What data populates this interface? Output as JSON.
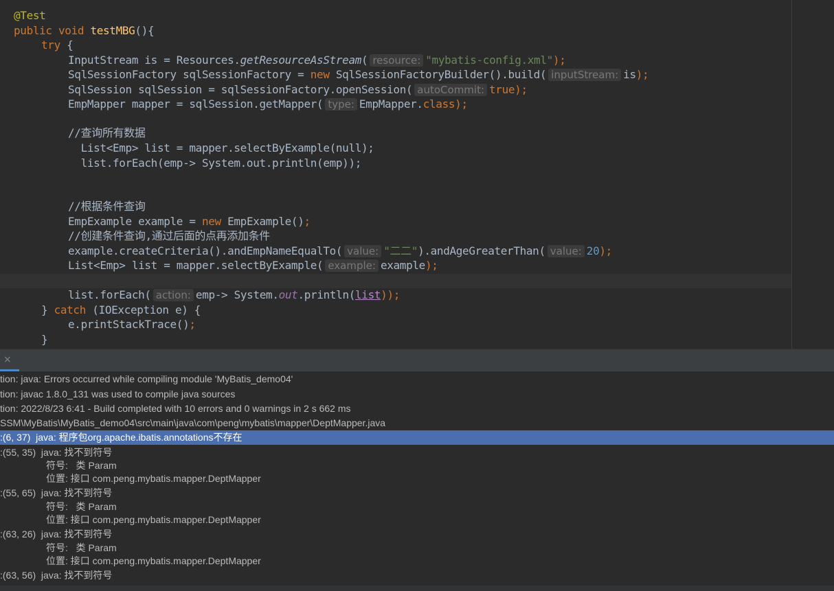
{
  "editor": {
    "annotation": "@Test",
    "method": {
      "modifier": "public",
      "return_type": "void",
      "name": "testMBG",
      "parens": "(){"
    },
    "try_kw": "try",
    "open_brace": " {",
    "line4": {
      "prefix": "InputStream is = Resources.",
      "call": "getResourceAsStream",
      "open": "(",
      "hint": "resource:",
      "arg": "\"mybatis-config.xml\"",
      "close": ");"
    },
    "line5": {
      "prefix": "SqlSessionFactory sqlSessionFactory = ",
      "new_kw": "new",
      "mid": " SqlSessionFactoryBuilder().build(",
      "hint": "inputStream:",
      "arg": "is",
      "close": ");"
    },
    "line6": {
      "prefix": "SqlSession sqlSession = sqlSessionFactory.openSession(",
      "hint": "autoCommit:",
      "arg": "true",
      "close": ");"
    },
    "line7": {
      "prefix": "EmpMapper mapper = sqlSession.getMapper(",
      "hint": "type:",
      "arg": "EmpMapper.",
      "class_kw": "class",
      "close": ");"
    },
    "comment1": "//查询所有数据",
    "line9": "  List<Emp> list = mapper.selectByExample(null);",
    "line10": "  list.forEach(emp-> System.out.println(emp));",
    "comment2": "//根据条件查询",
    "line14": {
      "prefix": "EmpExample example = ",
      "new_kw": "new",
      "mid": " EmpExample()",
      "close": ";"
    },
    "comment3": "//创建条件查询,通过后面的点再添加条件",
    "line16": {
      "prefix": "example.createCriteria().andEmpNameEqualTo(",
      "hint1": "value:",
      "arg1": "\"二二\"",
      "mid": ").andAgeGreaterThan(",
      "hint2": "value:",
      "arg2": "20",
      "close": ");"
    },
    "line17": {
      "prefix": "List<Emp> list = mapper.selectByExample(",
      "hint": "example:",
      "arg": "example",
      "close": ");"
    },
    "line19": {
      "prefix": "list.forEach(",
      "hint": "action:",
      "mid": "emp-> System.",
      "field": "out",
      "mid2": ".println(",
      "var": "list",
      "close": "));"
    },
    "catch_line": {
      "brace": "} ",
      "catch_kw": "catch",
      "rest": " (IOException e) {"
    },
    "print_stack": "e.printStackTrace()",
    "semicolon": ";",
    "close_brace": "}"
  },
  "messages": {
    "close_icon": "×",
    "lines": [
      "tion: java: Errors occurred while compiling module 'MyBatis_demo04'",
      "tion: javac 1.8.0_131 was used to compile java sources",
      "tion: 2022/8/23 6:41 - Build completed with 10 errors and 0 warnings in 2 s 662 ms",
      "SSM\\MyBatis\\MyBatis_demo04\\src\\main\\java\\com\\peng\\mybatis\\mapper\\DeptMapper.java"
    ],
    "selected": ":(6, 37)  java: 程序包org.apache.ibatis.annotations不存在",
    "errors": [
      {
        "loc": ":(55, 35)  java: 找不到符号",
        "symbol": "符号:   类 Param",
        "location": "位置: 接口 com.peng.mybatis.mapper.DeptMapper"
      },
      {
        "loc": ":(55, 65)  java: 找不到符号",
        "symbol": "符号:   类 Param",
        "location": "位置: 接口 com.peng.mybatis.mapper.DeptMapper"
      },
      {
        "loc": ":(63, 26)  java: 找不到符号",
        "symbol": "符号:   类 Param",
        "location": "位置: 接口 com.peng.mybatis.mapper.DeptMapper"
      },
      {
        "loc": ":(63, 56)  java: 找不到符号"
      }
    ]
  },
  "colors": {
    "background": "#2b2b2b",
    "keyword": "#cc7832",
    "annotation": "#bbb529",
    "string": "#6a8759",
    "number": "#6897bb",
    "comment": "#629755",
    "selection": "#4b6eaf"
  }
}
